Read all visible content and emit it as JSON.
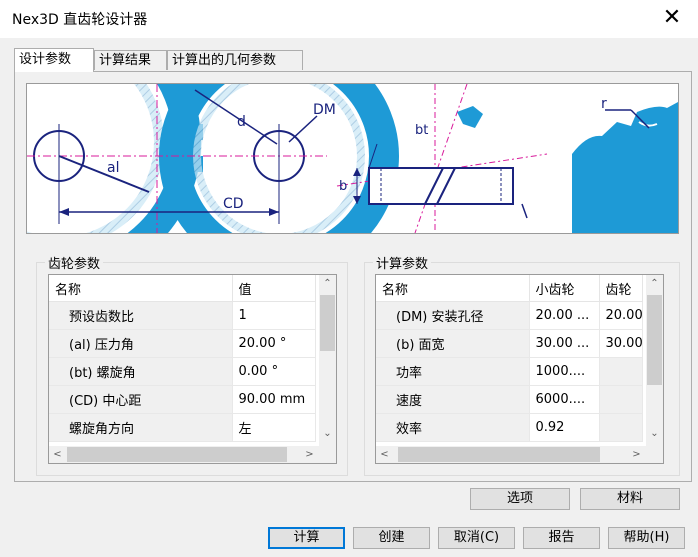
{
  "window": {
    "title": "Nex3D 直齿轮设计器",
    "close": "✕"
  },
  "tabs": [
    {
      "label": "设计参数",
      "active": true
    },
    {
      "label": "计算结果",
      "active": false
    },
    {
      "label": "计算出的几何参数",
      "active": false
    }
  ],
  "banner": {
    "labels": {
      "al": "al",
      "d": "d",
      "DM": "DM",
      "CD": "CD",
      "bt": "bt",
      "b": "b",
      "r": "r"
    }
  },
  "gear_params": {
    "title": "齿轮参数",
    "columns": [
      "名称",
      "值"
    ],
    "rows": [
      {
        "name": "预设齿数比",
        "value": "1"
      },
      {
        "name": "(al) 压力角",
        "value": "20.00 °"
      },
      {
        "name": "(bt) 螺旋角",
        "value": "0.00 °"
      },
      {
        "name": "(CD) 中心距",
        "value": "90.00 mm"
      },
      {
        "name": "螺旋角方向",
        "value": "左"
      }
    ],
    "scroll_up": "⌃",
    "scroll_down": "⌄",
    "scroll_left": "<",
    "scroll_right": ">"
  },
  "calc_params": {
    "title": "计算参数",
    "columns": [
      "名称",
      "小齿轮",
      "齿轮"
    ],
    "rows": [
      {
        "name": "(DM) 安装孔径",
        "pinion": "20.00 ...",
        "gear": "20.00"
      },
      {
        "name": "(b) 面宽",
        "pinion": "30.00 ...",
        "gear": "30.00"
      },
      {
        "name": "功率",
        "pinion": "1000....",
        "gear": ""
      },
      {
        "name": "速度",
        "pinion": "6000....",
        "gear": ""
      },
      {
        "name": "效率",
        "pinion": "0.92",
        "gear": ""
      }
    ],
    "scroll_up": "⌃",
    "scroll_down": "⌄",
    "scroll_left": "<",
    "scroll_right": ">"
  },
  "buttons": {
    "options": "选项",
    "material": "材料",
    "calculate": "计算",
    "create": "创建",
    "cancel": "取消(C)",
    "report": "报告",
    "help": "帮助(H)"
  },
  "colors": {
    "gear_blue": "#1e9ad6",
    "dark_blue": "#1a237e",
    "magenta": "#d81b9b",
    "accent": "#0078d7"
  }
}
